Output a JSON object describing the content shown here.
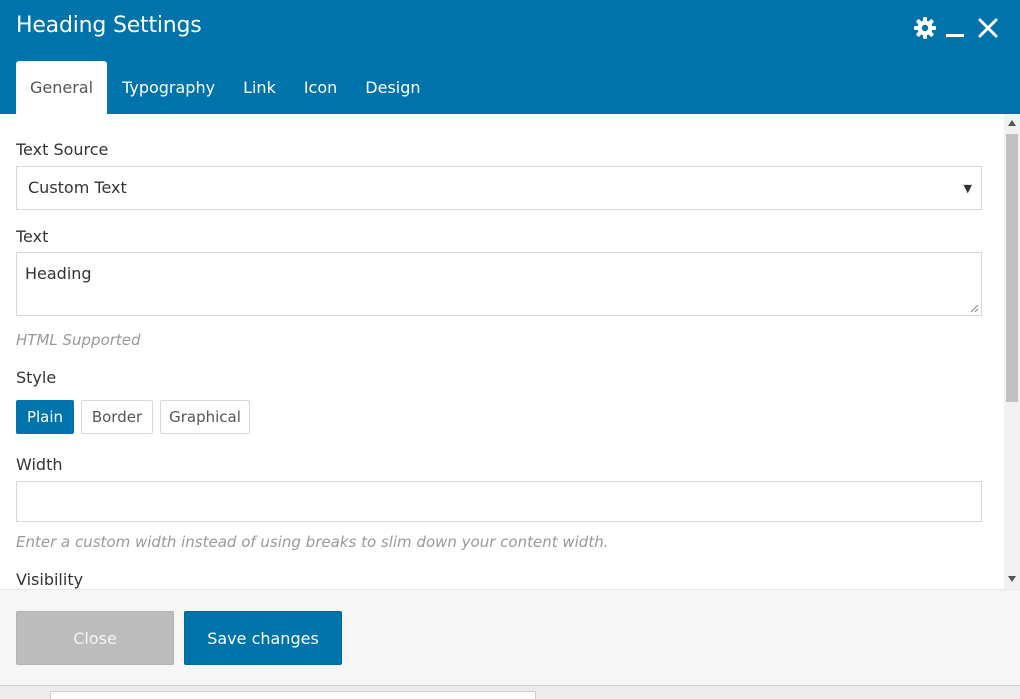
{
  "window": {
    "title": "Heading Settings"
  },
  "icons": {
    "settings": "gear-icon",
    "minimize": "minimize-icon",
    "close": "close-icon"
  },
  "tabs": [
    {
      "label": "General",
      "active": true
    },
    {
      "label": "Typography",
      "active": false
    },
    {
      "label": "Link",
      "active": false
    },
    {
      "label": "Icon",
      "active": false
    },
    {
      "label": "Design",
      "active": false
    }
  ],
  "fields": {
    "text_source": {
      "label": "Text Source",
      "value": "Custom Text"
    },
    "text": {
      "label": "Text",
      "value": "Heading",
      "help": "HTML Supported"
    },
    "style": {
      "label": "Style",
      "options": [
        "Plain",
        "Border",
        "Graphical"
      ],
      "selected": "Plain"
    },
    "width": {
      "label": "Width",
      "value": "",
      "help": "Enter a custom width instead of using breaks to slim down your content width."
    },
    "visibility": {
      "label": "Visibility"
    }
  },
  "footer": {
    "close_label": "Close",
    "save_label": "Save changes"
  },
  "colors": {
    "primary": "#0073aa",
    "close_button": "#bcbcbc",
    "footer_bg": "#f6f6f6"
  }
}
